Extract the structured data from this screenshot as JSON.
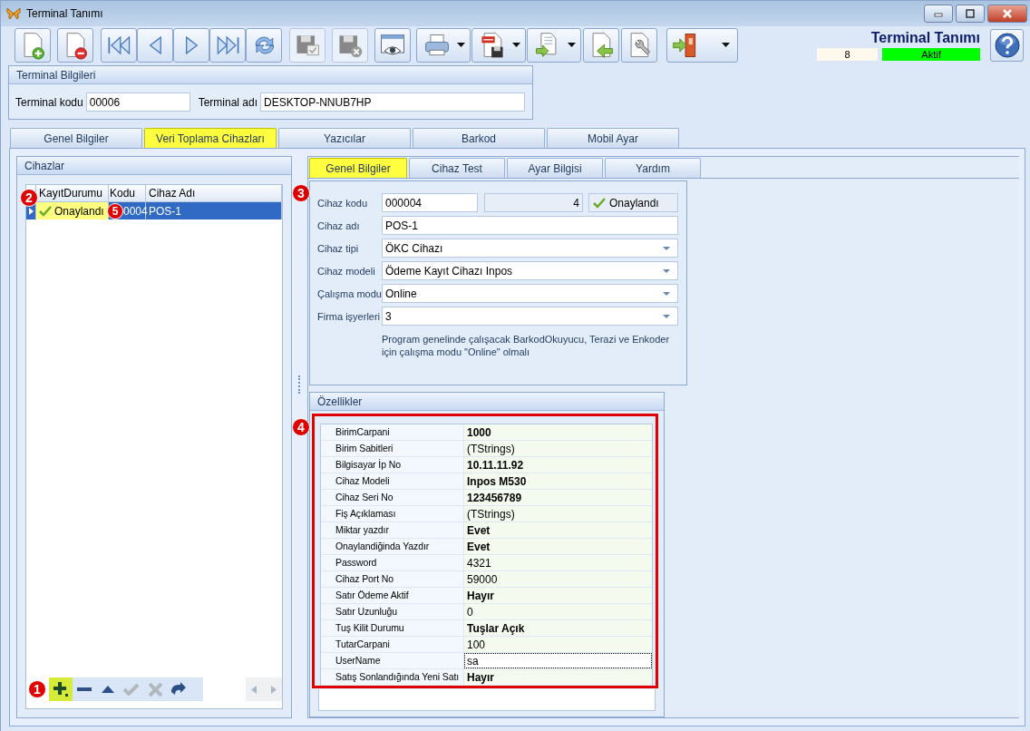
{
  "window": {
    "title": "Terminal Tanımı"
  },
  "toolbar": {
    "buttons": [
      {
        "kind": "new",
        "dropdown": false,
        "disabled": false
      },
      {
        "kind": "delete",
        "dropdown": false,
        "disabled": false
      },
      {
        "kind": "first",
        "dropdown": false,
        "disabled": false
      },
      {
        "kind": "prev",
        "dropdown": false,
        "disabled": false
      },
      {
        "kind": "next",
        "dropdown": false,
        "disabled": false
      },
      {
        "kind": "last",
        "dropdown": false,
        "disabled": false
      },
      {
        "kind": "refresh",
        "dropdown": false,
        "disabled": false
      },
      {
        "kind": "save",
        "dropdown": false,
        "disabled": true
      },
      {
        "kind": "cancel",
        "dropdown": false,
        "disabled": true
      },
      {
        "kind": "preview",
        "dropdown": false,
        "disabled": false
      },
      {
        "kind": "print",
        "dropdown": true,
        "disabled": false
      },
      {
        "kind": "pdf",
        "dropdown": true,
        "disabled": false
      },
      {
        "kind": "export",
        "dropdown": true,
        "disabled": false
      },
      {
        "kind": "import",
        "dropdown": false,
        "disabled": false
      },
      {
        "kind": "settings",
        "dropdown": false,
        "disabled": false
      },
      {
        "kind": "exit",
        "dropdown": true,
        "disabled": false
      }
    ]
  },
  "header": {
    "title": "Terminal Tanımı",
    "record": "8",
    "status": "Aktif"
  },
  "terminal_info": {
    "title": "Terminal Bilgileri",
    "fields": [
      {
        "label": "Terminal kodu",
        "value": "00006"
      },
      {
        "label": "Terminal adı",
        "value": "DESKTOP-NNUB7HP"
      }
    ]
  },
  "main_tabs": [
    {
      "label": "Genel Bilgiler",
      "selected": false
    },
    {
      "label": "Veri Toplama Cihazları",
      "selected": true
    },
    {
      "label": "Yazıcılar",
      "selected": false
    },
    {
      "label": "Barkod",
      "selected": false
    },
    {
      "label": "Mobil Ayar",
      "selected": false
    }
  ],
  "devices": {
    "title": "Cihazlar",
    "columns": [
      "KayıtDurumu",
      "Kodu",
      "Cihaz Adı"
    ],
    "status_callout": "2",
    "code_callout": "5",
    "nav_callout": "1",
    "rows": [
      {
        "status": "Onaylandı",
        "code": "0004",
        "name": "POS-1",
        "selected": true
      }
    ],
    "nav_buttons": [
      {
        "kind": "add",
        "disabled": false,
        "highlighted": true
      },
      {
        "kind": "remove",
        "disabled": false,
        "highlighted": false
      },
      {
        "kind": "up",
        "disabled": false,
        "highlighted": false
      },
      {
        "kind": "confirm",
        "disabled": true,
        "highlighted": false
      },
      {
        "kind": "cancel",
        "disabled": true,
        "highlighted": false
      },
      {
        "kind": "redo",
        "disabled": false,
        "highlighted": false
      }
    ]
  },
  "sub_tabs": [
    {
      "label": "Genel Bilgiler",
      "selected": true
    },
    {
      "label": "Cihaz Test",
      "selected": false
    },
    {
      "label": "Ayar Bilgisi",
      "selected": false
    },
    {
      "label": "Yardım",
      "selected": false
    }
  ],
  "device_form": {
    "callout": "3",
    "code_label": "Cihaz kodu",
    "code": "000004",
    "number": "4",
    "status": "Onaylandı",
    "fields": [
      {
        "label": "Cihaz adı",
        "value": "POS-1",
        "kind": "text"
      },
      {
        "label": "Cihaz tipi",
        "value": "ÖKC Cihazı",
        "kind": "dropdown"
      },
      {
        "label": "Cihaz modeli",
        "value": "Ödeme Kayıt Cihazı Inpos",
        "kind": "dropdown"
      },
      {
        "label": "Çalışma modu",
        "value": "Online",
        "kind": "dropdown"
      },
      {
        "label": "Firma işyerleri",
        "value": "3",
        "kind": "dropdown"
      }
    ],
    "note": "Program genelinde çalışacak BarkodOkuyucu, Terazi ve Enkoder için çalışma modu \"Online\" olmalı"
  },
  "properties": {
    "title": "Özellikler",
    "callout": "4",
    "rows": [
      {
        "name": "BirimCarpani",
        "value": "1000",
        "bold": true,
        "focused": false
      },
      {
        "name": "Birim Sabitleri",
        "value": "(TStrings)",
        "bold": false,
        "focused": false
      },
      {
        "name": "Bilgisayar İp No",
        "value": "10.11.11.92",
        "bold": true,
        "focused": false
      },
      {
        "name": "Cihaz Modeli",
        "value": "Inpos M530",
        "bold": true,
        "focused": false
      },
      {
        "name": "Cihaz Seri No",
        "value": "123456789",
        "bold": true,
        "focused": false
      },
      {
        "name": "Fiş Açıklaması",
        "value": "(TStrings)",
        "bold": false,
        "focused": false
      },
      {
        "name": "Miktar yazdır",
        "value": "Evet",
        "bold": true,
        "focused": false
      },
      {
        "name": "Onaylandiğinda Yazdır",
        "value": "Evet",
        "bold": true,
        "focused": false
      },
      {
        "name": "Password",
        "value": "4321",
        "bold": false,
        "focused": false
      },
      {
        "name": "Cihaz Port No",
        "value": "59000",
        "bold": false,
        "focused": false
      },
      {
        "name": "Satır Ödeme Aktif",
        "value": "Hayır",
        "bold": true,
        "focused": false
      },
      {
        "name": "Satır Uzunluğu",
        "value": "0",
        "bold": false,
        "focused": false
      },
      {
        "name": "Tuş Kilit Durumu",
        "value": "Tuşlar Açık",
        "bold": true,
        "focused": false
      },
      {
        "name": "TutarCarpani",
        "value": "100",
        "bold": false,
        "focused": false
      },
      {
        "name": "UserName",
        "value": "sa",
        "bold": false,
        "focused": true
      },
      {
        "name": "Satış Sonlandığında Yeni Satı",
        "value": "Hayır",
        "bold": true,
        "focused": false
      }
    ]
  }
}
